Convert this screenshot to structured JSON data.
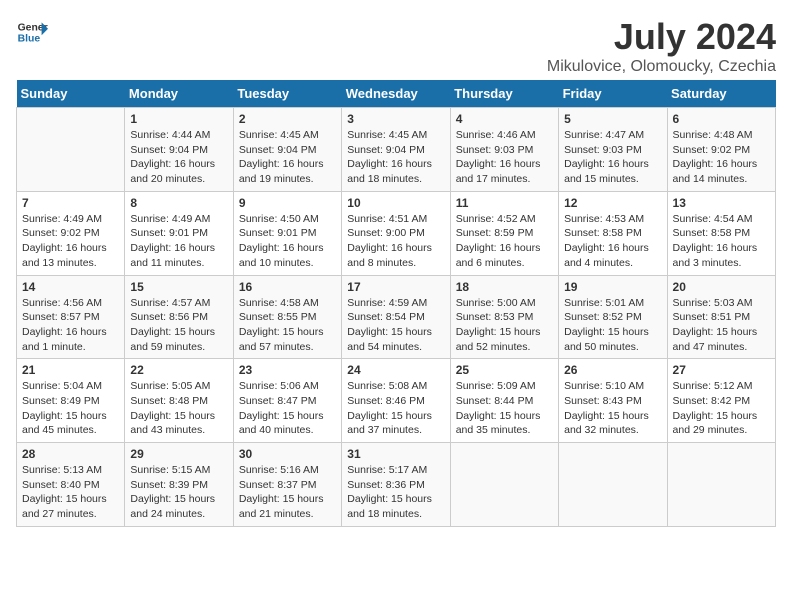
{
  "header": {
    "logo_line1": "General",
    "logo_line2": "Blue",
    "title": "July 2024",
    "subtitle": "Mikulovice, Olomoucky, Czechia"
  },
  "weekdays": [
    "Sunday",
    "Monday",
    "Tuesday",
    "Wednesday",
    "Thursday",
    "Friday",
    "Saturday"
  ],
  "weeks": [
    [
      {
        "day": "",
        "empty": true
      },
      {
        "day": "1",
        "sunrise": "4:44 AM",
        "sunset": "9:04 PM",
        "daylight": "16 hours and 20 minutes."
      },
      {
        "day": "2",
        "sunrise": "4:45 AM",
        "sunset": "9:04 PM",
        "daylight": "16 hours and 19 minutes."
      },
      {
        "day": "3",
        "sunrise": "4:45 AM",
        "sunset": "9:04 PM",
        "daylight": "16 hours and 18 minutes."
      },
      {
        "day": "4",
        "sunrise": "4:46 AM",
        "sunset": "9:03 PM",
        "daylight": "16 hours and 17 minutes."
      },
      {
        "day": "5",
        "sunrise": "4:47 AM",
        "sunset": "9:03 PM",
        "daylight": "16 hours and 15 minutes."
      },
      {
        "day": "6",
        "sunrise": "4:48 AM",
        "sunset": "9:02 PM",
        "daylight": "16 hours and 14 minutes."
      }
    ],
    [
      {
        "day": "7",
        "sunrise": "4:49 AM",
        "sunset": "9:02 PM",
        "daylight": "16 hours and 13 minutes."
      },
      {
        "day": "8",
        "sunrise": "4:49 AM",
        "sunset": "9:01 PM",
        "daylight": "16 hours and 11 minutes."
      },
      {
        "day": "9",
        "sunrise": "4:50 AM",
        "sunset": "9:01 PM",
        "daylight": "16 hours and 10 minutes."
      },
      {
        "day": "10",
        "sunrise": "4:51 AM",
        "sunset": "9:00 PM",
        "daylight": "16 hours and 8 minutes."
      },
      {
        "day": "11",
        "sunrise": "4:52 AM",
        "sunset": "8:59 PM",
        "daylight": "16 hours and 6 minutes."
      },
      {
        "day": "12",
        "sunrise": "4:53 AM",
        "sunset": "8:58 PM",
        "daylight": "16 hours and 4 minutes."
      },
      {
        "day": "13",
        "sunrise": "4:54 AM",
        "sunset": "8:58 PM",
        "daylight": "16 hours and 3 minutes."
      }
    ],
    [
      {
        "day": "14",
        "sunrise": "4:56 AM",
        "sunset": "8:57 PM",
        "daylight": "16 hours and 1 minute."
      },
      {
        "day": "15",
        "sunrise": "4:57 AM",
        "sunset": "8:56 PM",
        "daylight": "15 hours and 59 minutes."
      },
      {
        "day": "16",
        "sunrise": "4:58 AM",
        "sunset": "8:55 PM",
        "daylight": "15 hours and 57 minutes."
      },
      {
        "day": "17",
        "sunrise": "4:59 AM",
        "sunset": "8:54 PM",
        "daylight": "15 hours and 54 minutes."
      },
      {
        "day": "18",
        "sunrise": "5:00 AM",
        "sunset": "8:53 PM",
        "daylight": "15 hours and 52 minutes."
      },
      {
        "day": "19",
        "sunrise": "5:01 AM",
        "sunset": "8:52 PM",
        "daylight": "15 hours and 50 minutes."
      },
      {
        "day": "20",
        "sunrise": "5:03 AM",
        "sunset": "8:51 PM",
        "daylight": "15 hours and 47 minutes."
      }
    ],
    [
      {
        "day": "21",
        "sunrise": "5:04 AM",
        "sunset": "8:49 PM",
        "daylight": "15 hours and 45 minutes."
      },
      {
        "day": "22",
        "sunrise": "5:05 AM",
        "sunset": "8:48 PM",
        "daylight": "15 hours and 43 minutes."
      },
      {
        "day": "23",
        "sunrise": "5:06 AM",
        "sunset": "8:47 PM",
        "daylight": "15 hours and 40 minutes."
      },
      {
        "day": "24",
        "sunrise": "5:08 AM",
        "sunset": "8:46 PM",
        "daylight": "15 hours and 37 minutes."
      },
      {
        "day": "25",
        "sunrise": "5:09 AM",
        "sunset": "8:44 PM",
        "daylight": "15 hours and 35 minutes."
      },
      {
        "day": "26",
        "sunrise": "5:10 AM",
        "sunset": "8:43 PM",
        "daylight": "15 hours and 32 minutes."
      },
      {
        "day": "27",
        "sunrise": "5:12 AM",
        "sunset": "8:42 PM",
        "daylight": "15 hours and 29 minutes."
      }
    ],
    [
      {
        "day": "28",
        "sunrise": "5:13 AM",
        "sunset": "8:40 PM",
        "daylight": "15 hours and 27 minutes."
      },
      {
        "day": "29",
        "sunrise": "5:15 AM",
        "sunset": "8:39 PM",
        "daylight": "15 hours and 24 minutes."
      },
      {
        "day": "30",
        "sunrise": "5:16 AM",
        "sunset": "8:37 PM",
        "daylight": "15 hours and 21 minutes."
      },
      {
        "day": "31",
        "sunrise": "5:17 AM",
        "sunset": "8:36 PM",
        "daylight": "15 hours and 18 minutes."
      },
      {
        "day": "",
        "empty": true
      },
      {
        "day": "",
        "empty": true
      },
      {
        "day": "",
        "empty": true
      }
    ]
  ]
}
